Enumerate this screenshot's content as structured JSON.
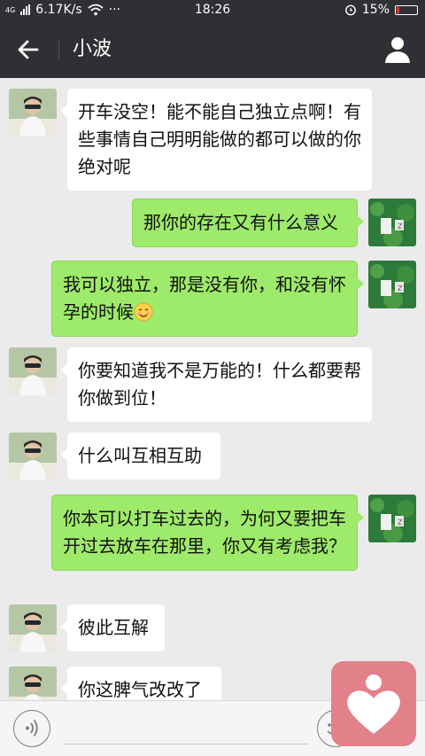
{
  "status_bar": {
    "network_type": "4G",
    "speed": "6.17K/s",
    "more": "···",
    "time": "18:26",
    "battery": "15%",
    "battery_level": 0.15,
    "battery_color": "#e8332c"
  },
  "header": {
    "title": "小波",
    "back_icon": "back-arrow-icon",
    "profile_icon": "person-icon"
  },
  "colors": {
    "header_bg": "#2e3033",
    "chat_bg": "#ebebeb",
    "bubble_out": "#9eea6a",
    "bubble_in": "#ffffff",
    "app_icon_bg": "#e2818a"
  },
  "messages": [
    {
      "side": "in",
      "text": "开车没空！能不能自己独立点啊！有些事情自己明明能做的都可以做的你绝对呢"
    },
    {
      "side": "out",
      "text": "那你的存在又有什么意义"
    },
    {
      "side": "out",
      "text": "我可以独立，那是没有你，和没有怀孕的时候",
      "emoji": "smile-emoji"
    },
    {
      "side": "in",
      "text": "你要知道我不是万能的！什么都要帮你做到位！"
    },
    {
      "side": "in",
      "text": "什么叫互相互助"
    },
    {
      "side": "out",
      "text": "你本可以打车过去的，为何又要把车开过去放车在那里，你又有考虑我？"
    },
    {
      "side": "in",
      "text": "彼此互解"
    },
    {
      "side": "in",
      "text": "你这脾气改改了"
    }
  ],
  "input_bar": {
    "voice_icon": "voice-icon",
    "emoji_icon": "emoji-icon",
    "overlay_app_icon": "heart-app-icon"
  }
}
